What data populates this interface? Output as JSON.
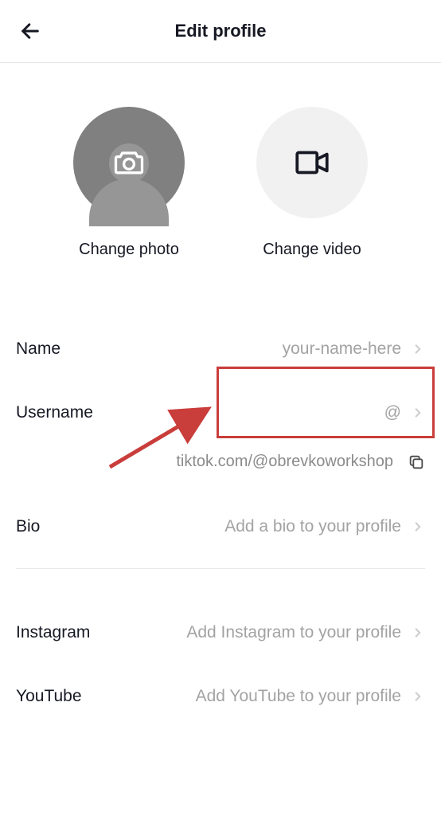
{
  "header": {
    "title": "Edit profile"
  },
  "avatar": {
    "photo_label": "Change photo",
    "video_label": "Change video"
  },
  "settings": {
    "name": {
      "label": "Name",
      "value": "your-name-here"
    },
    "username": {
      "label": "Username",
      "value": "@"
    },
    "url": "tiktok.com/@obrevkoworkshop",
    "bio": {
      "label": "Bio",
      "value": "Add a bio to your profile"
    },
    "instagram": {
      "label": "Instagram",
      "value": "Add Instagram to your profile"
    },
    "youtube": {
      "label": "YouTube",
      "value": "Add YouTube to your profile"
    }
  }
}
